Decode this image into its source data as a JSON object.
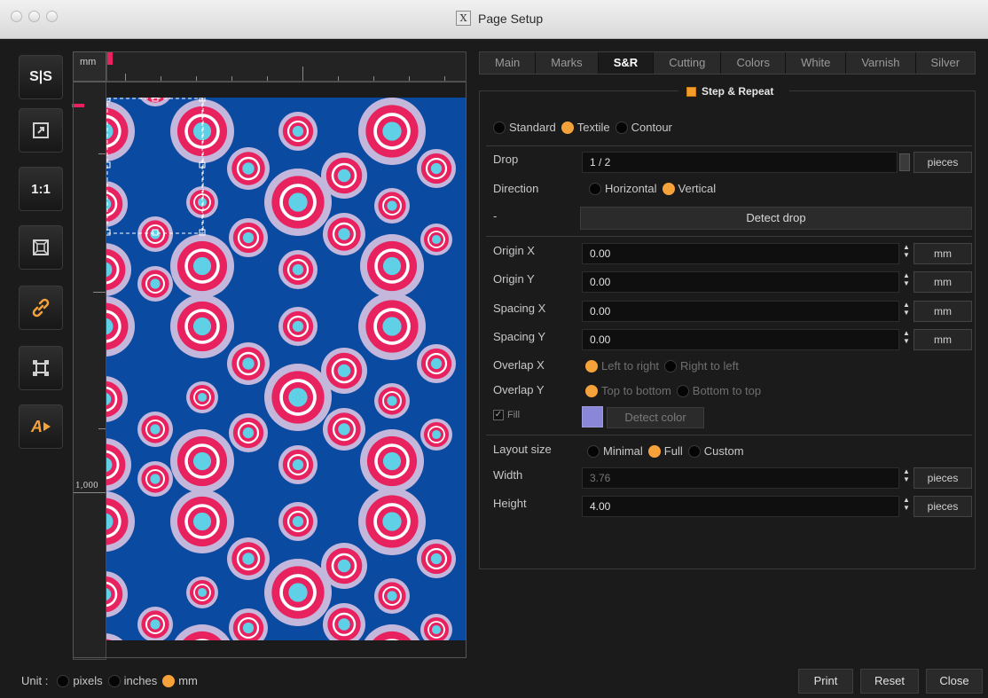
{
  "window": {
    "title": "Page Setup",
    "app_icon": "x11-icon"
  },
  "toolbar": {
    "items": [
      {
        "name": "logo-icon",
        "text": "S|S"
      },
      {
        "name": "export-icon"
      },
      {
        "name": "actual-size-icon",
        "text": "1:1"
      },
      {
        "name": "fit-page-icon"
      },
      {
        "name": "link-icon"
      },
      {
        "name": "transform-icon"
      },
      {
        "name": "text-tool-icon",
        "text": "A"
      }
    ]
  },
  "preview": {
    "ruler_unit": "mm",
    "ruler_mark": "1,000",
    "pattern_colors": {
      "background": "#0b4aa1",
      "outer_ring": "#c3b8dc",
      "mid_ring": "#e8225e",
      "inner_ring": "#ffffff",
      "center": "#5fd0e6"
    }
  },
  "tabs": [
    {
      "label": "Main",
      "active": false
    },
    {
      "label": "Marks",
      "active": false
    },
    {
      "label": "S&R",
      "active": true
    },
    {
      "label": "Cutting",
      "active": false
    },
    {
      "label": "Colors",
      "active": false
    },
    {
      "label": "White",
      "active": false
    },
    {
      "label": "Varnish",
      "active": false
    },
    {
      "label": "Silver",
      "active": false
    }
  ],
  "step_repeat": {
    "title": "Step & Repeat",
    "enabled": true,
    "mode_options": [
      "Standard",
      "Textile",
      "Contour"
    ],
    "mode_selected": "Textile",
    "drop": {
      "label": "Drop",
      "value": "1 / 2",
      "unit": "pieces"
    },
    "direction": {
      "label": "Direction",
      "options": [
        "Horizontal",
        "Vertical"
      ],
      "selected": "Vertical"
    },
    "detect_drop_label": "Detect drop",
    "dash": "-",
    "origin_x": {
      "label": "Origin X",
      "value": "0.00",
      "unit": "mm"
    },
    "origin_y": {
      "label": "Origin Y",
      "value": "0.00",
      "unit": "mm"
    },
    "spacing_x": {
      "label": "Spacing X",
      "value": "0.00",
      "unit": "mm"
    },
    "spacing_y": {
      "label": "Spacing Y",
      "value": "0.00",
      "unit": "mm"
    },
    "overlap_x": {
      "label": "Overlap X",
      "options": [
        "Left to right",
        "Right to left"
      ],
      "selected": "Left to right"
    },
    "overlap_y": {
      "label": "Overlap Y",
      "options": [
        "Top to bottom",
        "Bottom to top"
      ],
      "selected": "Top to bottom"
    },
    "fill": {
      "label": "Fill",
      "detect_color_label": "Detect color",
      "swatch_color": "#8b87d8"
    },
    "layout_size": {
      "label": "Layout size",
      "options": [
        "Minimal",
        "Full",
        "Custom"
      ],
      "selected": "Full"
    },
    "width": {
      "label": "Width",
      "value": "3.76",
      "unit": "pieces"
    },
    "height": {
      "label": "Height",
      "value": "4.00",
      "unit": "pieces"
    }
  },
  "footer": {
    "unit_label": "Unit",
    "unit_options": [
      "pixels",
      "inches",
      "mm"
    ],
    "unit_selected": "mm",
    "print_label": "Print",
    "reset_label": "Reset",
    "close_label": "Close"
  },
  "colors": {
    "accent": "#f6a23a",
    "panel_bg": "#1b1b1b",
    "field_bg": "#0f0f0f"
  }
}
